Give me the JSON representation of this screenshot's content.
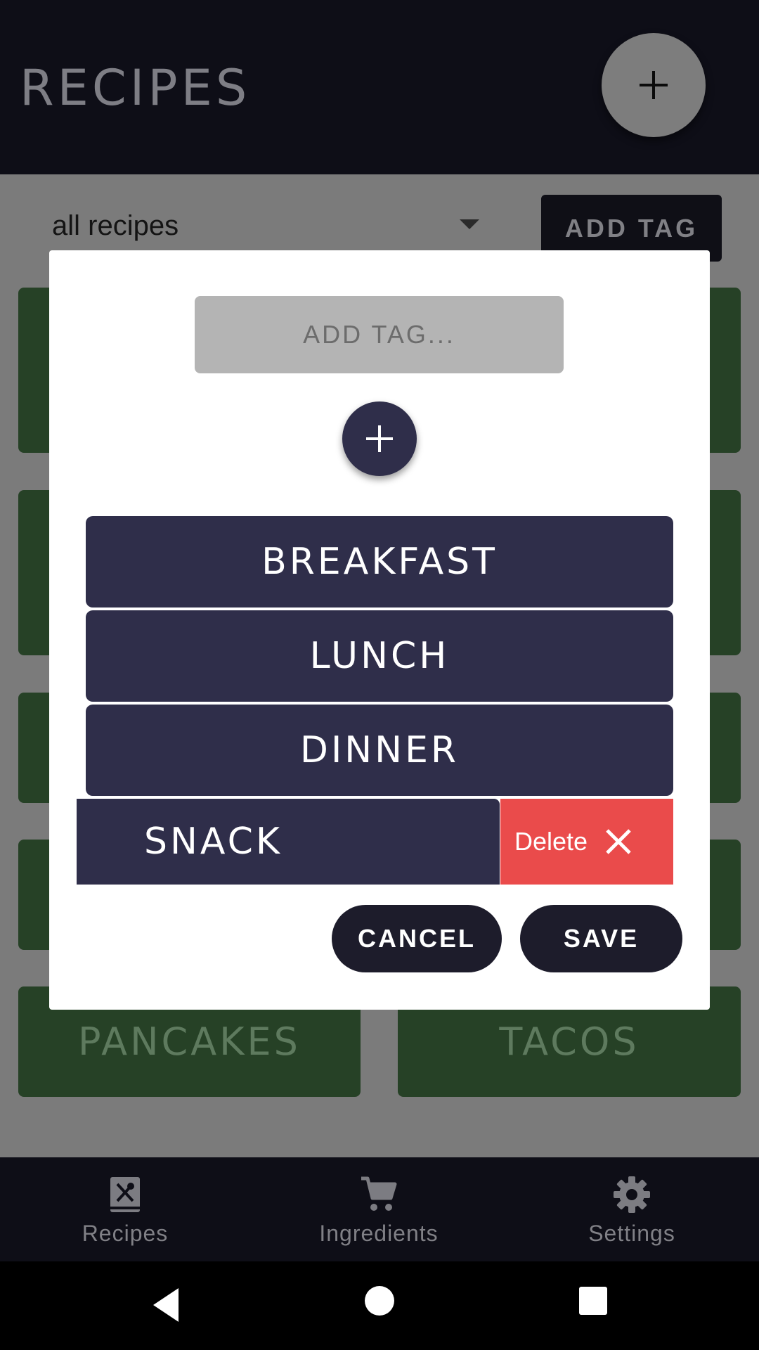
{
  "app": {
    "title": "RECIPES",
    "add_icon": "plus-icon",
    "filter": {
      "selected": "all recipes"
    },
    "add_tag_label": "ADD TAG",
    "recipe_cards": [
      "PANCAKES",
      "TACOS"
    ]
  },
  "dialog": {
    "tag_input_placeholder": "ADD TAG...",
    "add_icon": "plus-icon",
    "tags": [
      "BREAKFAST",
      "LUNCH",
      "DINNER",
      "SNACK"
    ],
    "delete_label": "Delete",
    "cancel_label": "CANCEL",
    "save_label": "SAVE"
  },
  "bottom_nav": [
    {
      "label": "Recipes",
      "icon": "recipe-book-icon"
    },
    {
      "label": "Ingredients",
      "icon": "cart-icon"
    },
    {
      "label": "Settings",
      "icon": "gear-icon"
    }
  ],
  "colors": {
    "header": "#0e0e17",
    "tag_pill": "#2f2e4a",
    "delete": "#ea4b4b",
    "recipe_card": "#264126",
    "dialog_button": "#1d1c2b"
  }
}
